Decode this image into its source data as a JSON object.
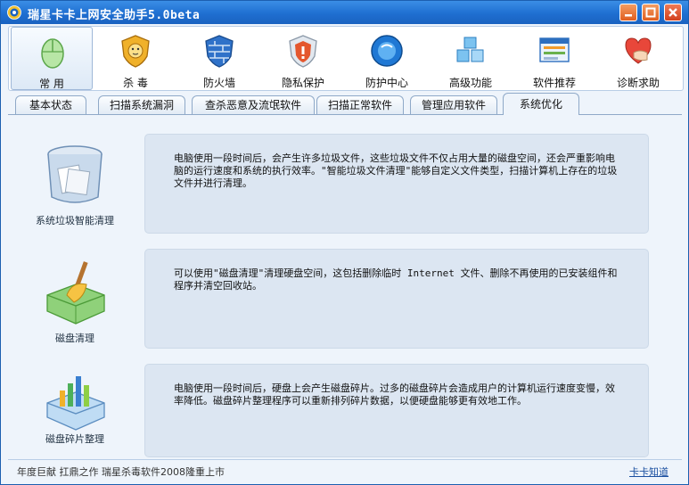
{
  "window": {
    "title": "瑞星卡卡上网安全助手5.0beta"
  },
  "toolbar": {
    "items": [
      {
        "label": "常 用",
        "icon": "mouse-icon"
      },
      {
        "label": "杀 毒",
        "icon": "lion-shield-icon"
      },
      {
        "label": "防火墙",
        "icon": "firewall-shield-icon"
      },
      {
        "label": "隐私保护",
        "icon": "privacy-shield-icon"
      },
      {
        "label": "防护中心",
        "icon": "globe-icon"
      },
      {
        "label": "高级功能",
        "icon": "cubes-icon"
      },
      {
        "label": "软件推荐",
        "icon": "window-icon"
      },
      {
        "label": "诊断求助",
        "icon": "heart-hand-icon"
      }
    ],
    "active_index": 0
  },
  "tabs": {
    "items": [
      "基本状态",
      "扫描系统漏洞",
      "查杀恶意及流氓软件",
      "扫描正常软件",
      "管理应用软件",
      "系统优化"
    ],
    "active_index": 5
  },
  "features": [
    {
      "label": "系统垃圾智能清理",
      "icon": "trash-bin-icon",
      "description": "电脑使用一段时间后，会产生许多垃圾文件，这些垃圾文件不仅占用大量的磁盘空间，还会严重影响电脑的运行速度和系统的执行效率。\"智能垃圾文件清理\"能够自定义文件类型，扫描计算机上存在的垃圾文件并进行清理。"
    },
    {
      "label": "磁盘清理",
      "icon": "disk-broom-icon",
      "description": "可以使用\"磁盘清理\"清理硬盘空间，这包括删除临时 Internet 文件、删除不再使用的已安装组件和程序并清空回收站。"
    },
    {
      "label": "磁盘碎片整理",
      "icon": "disk-chart-icon",
      "description": "电脑使用一段时间后，硬盘上会产生磁盘碎片。过多的磁盘碎片会造成用户的计算机运行速度变慢，效率降低。磁盘碎片整理程序可以重新排列碎片数据，以便硬盘能够更有效地工作。"
    }
  ],
  "statusbar": {
    "left_text": "年度巨献 扛鼎之作 瑞星杀毒软件2008隆重上市",
    "right_link": "卡卡知道"
  },
  "colors": {
    "titlebar": "#1f6fd1",
    "accent": "#1c5fb0",
    "panel": "#dce6f2",
    "background": "#eef4fb"
  }
}
